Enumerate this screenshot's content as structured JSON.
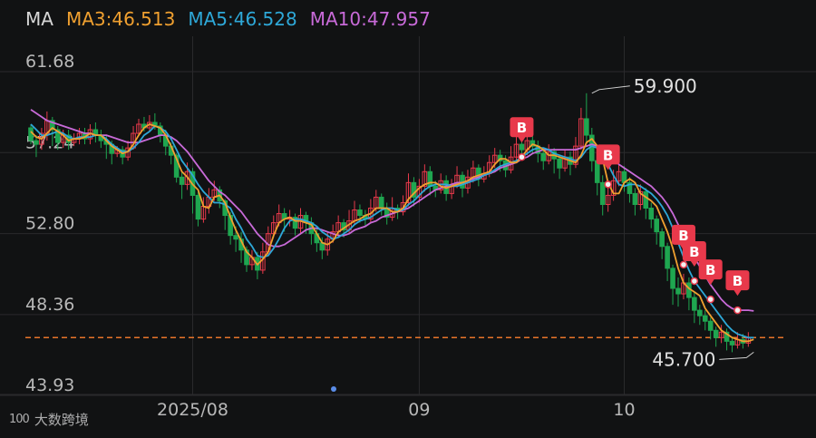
{
  "legend": {
    "ma_label": "MA",
    "ma3": "MA3:46.513",
    "ma5": "MA5:46.528",
    "ma10": "MA10:47.957"
  },
  "watermark": {
    "logo": "100",
    "text": "大数跨境"
  },
  "colors": {
    "background": "#111213",
    "grid": "#2a2a2c",
    "up": "#e8394b",
    "down": "#1fa650",
    "ma3": "#f0a030",
    "ma5": "#2ea8d8",
    "ma10": "#c86ad8",
    "current_line": "#e8742a",
    "axis_text": "#b8b8b8",
    "marker": "#e8394b"
  },
  "chart_data": {
    "type": "candlestick",
    "y_ticks": [
      "61.68",
      "57.24",
      "52.80",
      "48.36",
      "43.93"
    ],
    "y_tick_values": [
      61.68,
      57.24,
      52.8,
      48.36,
      43.93
    ],
    "x_ticks": [
      {
        "label": "2025/08",
        "index": 30
      },
      {
        "label": "09",
        "index": 72
      },
      {
        "label": "10",
        "index": 110
      }
    ],
    "grid": true,
    "current_price_line": 46.5,
    "max_label": "59.900",
    "max_value": 59.9,
    "max_index": 104,
    "min_label": "45.700",
    "min_value": 45.7,
    "min_index": 134,
    "buy_signal_label": "B",
    "buy_signals": [
      {
        "index": 91,
        "price": 56.4
      },
      {
        "index": 107,
        "price": 54.9
      },
      {
        "index": 121,
        "price": 50.5
      },
      {
        "index": 123,
        "price": 49.6
      },
      {
        "index": 126,
        "price": 48.6
      },
      {
        "index": 131,
        "price": 48.0
      }
    ],
    "candles": [
      [
        58.0,
        57.3,
        58.2,
        57.1
      ],
      [
        57.3,
        57.1,
        57.6,
        56.4
      ],
      [
        57.1,
        57.7,
        58.0,
        56.8
      ],
      [
        57.7,
        58.4,
        58.9,
        57.3
      ],
      [
        58.4,
        57.9,
        58.6,
        57.0
      ],
      [
        57.9,
        57.2,
        58.1,
        56.8
      ],
      [
        57.2,
        57.6,
        57.9,
        56.9
      ],
      [
        57.6,
        57.2,
        57.9,
        56.8
      ],
      [
        57.2,
        57.4,
        57.7,
        57.0
      ],
      [
        57.4,
        57.7,
        58.0,
        57.1
      ],
      [
        57.7,
        57.4,
        58.0,
        57.1
      ],
      [
        57.4,
        57.9,
        58.2,
        57.1
      ],
      [
        57.9,
        57.6,
        58.3,
        57.2
      ],
      [
        57.6,
        57.3,
        57.9,
        56.9
      ],
      [
        57.3,
        57.1,
        57.6,
        56.3
      ],
      [
        57.1,
        56.6,
        57.3,
        56.0
      ],
      [
        56.6,
        56.8,
        57.0,
        56.4
      ],
      [
        56.8,
        56.4,
        57.0,
        56.0
      ],
      [
        56.4,
        56.9,
        57.3,
        56.2
      ],
      [
        56.9,
        57.7,
        58.1,
        56.8
      ],
      [
        57.7,
        58.2,
        58.5,
        57.6
      ],
      [
        58.2,
        58.0,
        58.6,
        57.8
      ],
      [
        58.0,
        58.3,
        58.7,
        57.8
      ],
      [
        58.3,
        58.1,
        58.8,
        57.9
      ],
      [
        58.1,
        57.6,
        58.3,
        57.2
      ],
      [
        57.6,
        57.0,
        57.9,
        56.5
      ],
      [
        57.0,
        56.5,
        57.2,
        56.0
      ],
      [
        56.5,
        55.3,
        56.6,
        55.0
      ],
      [
        55.3,
        54.9,
        55.6,
        54.1
      ],
      [
        54.9,
        55.6,
        56.1,
        54.6
      ],
      [
        55.6,
        54.3,
        55.8,
        53.3
      ],
      [
        54.3,
        53.0,
        54.5,
        52.6
      ],
      [
        53.0,
        53.7,
        54.2,
        52.8
      ],
      [
        53.7,
        54.2,
        54.7,
        53.3
      ],
      [
        54.2,
        54.6,
        55.1,
        54.0
      ],
      [
        54.6,
        54.0,
        54.8,
        53.6
      ],
      [
        54.0,
        53.2,
        54.1,
        52.4
      ],
      [
        53.2,
        52.1,
        53.4,
        51.6
      ],
      [
        52.1,
        51.9,
        52.6,
        51.2
      ],
      [
        51.9,
        51.3,
        52.3,
        50.6
      ],
      [
        51.3,
        50.5,
        51.5,
        50.1
      ],
      [
        50.5,
        50.9,
        51.3,
        50.2
      ],
      [
        50.9,
        50.2,
        51.2,
        49.7
      ],
      [
        50.2,
        51.2,
        51.7,
        50.0
      ],
      [
        51.2,
        52.2,
        52.6,
        51.0
      ],
      [
        52.2,
        52.8,
        53.2,
        52.0
      ],
      [
        52.8,
        53.3,
        53.8,
        52.6
      ],
      [
        53.3,
        53.0,
        53.6,
        52.3
      ],
      [
        53.0,
        53.1,
        53.5,
        52.6
      ],
      [
        53.1,
        52.5,
        53.3,
        52.1
      ],
      [
        52.5,
        53.2,
        53.6,
        52.2
      ],
      [
        53.2,
        52.8,
        53.4,
        52.2
      ],
      [
        52.8,
        52.2,
        53.1,
        51.6
      ],
      [
        52.2,
        51.7,
        52.5,
        51.2
      ],
      [
        51.7,
        51.3,
        52.0,
        50.8
      ],
      [
        51.3,
        51.9,
        52.3,
        51.0
      ],
      [
        51.9,
        52.3,
        52.7,
        51.7
      ],
      [
        52.3,
        52.8,
        53.2,
        52.1
      ],
      [
        52.8,
        52.4,
        53.0,
        52.0
      ],
      [
        52.4,
        52.9,
        53.5,
        52.2
      ],
      [
        52.9,
        53.5,
        54.0,
        52.7
      ],
      [
        53.5,
        53.2,
        53.8,
        52.8
      ],
      [
        53.2,
        53.0,
        53.5,
        52.6
      ],
      [
        53.0,
        53.6,
        54.1,
        52.8
      ],
      [
        53.6,
        54.2,
        54.6,
        53.4
      ],
      [
        54.2,
        53.6,
        54.4,
        53.2
      ],
      [
        53.6,
        53.1,
        53.9,
        52.7
      ],
      [
        53.1,
        53.6,
        54.2,
        52.9
      ],
      [
        53.6,
        53.4,
        53.8,
        53.0
      ],
      [
        53.4,
        53.9,
        54.3,
        53.2
      ],
      [
        53.9,
        55.0,
        55.5,
        53.7
      ],
      [
        55.0,
        54.2,
        55.3,
        53.7
      ],
      [
        54.2,
        54.8,
        55.2,
        53.9
      ],
      [
        54.8,
        55.6,
        56.0,
        54.5
      ],
      [
        55.6,
        54.8,
        55.9,
        54.3
      ],
      [
        54.8,
        54.6,
        55.1,
        54.2
      ],
      [
        54.6,
        55.1,
        55.5,
        54.4
      ],
      [
        55.1,
        54.4,
        55.4,
        54.0
      ],
      [
        54.4,
        54.9,
        55.2,
        54.1
      ],
      [
        54.9,
        55.4,
        55.9,
        54.7
      ],
      [
        55.4,
        54.7,
        55.6,
        54.2
      ],
      [
        54.7,
        55.3,
        55.7,
        54.4
      ],
      [
        55.3,
        55.8,
        56.2,
        55.0
      ],
      [
        55.8,
        55.2,
        56.0,
        54.8
      ],
      [
        55.2,
        55.5,
        55.9,
        55.0
      ],
      [
        55.5,
        56.1,
        56.5,
        55.3
      ],
      [
        56.1,
        56.5,
        56.9,
        55.8
      ],
      [
        56.5,
        56.2,
        56.8,
        55.6
      ],
      [
        56.2,
        55.7,
        56.5,
        55.3
      ],
      [
        55.7,
        56.4,
        57.0,
        55.5
      ],
      [
        56.4,
        57.1,
        57.6,
        56.1
      ],
      [
        57.1,
        56.8,
        57.4,
        56.3
      ],
      [
        56.8,
        57.3,
        57.7,
        56.5
      ],
      [
        57.3,
        57.0,
        57.6,
        56.6
      ],
      [
        57.0,
        56.6,
        57.3,
        56.1
      ],
      [
        56.6,
        56.2,
        56.9,
        55.7
      ],
      [
        56.2,
        56.7,
        57.1,
        56.0
      ],
      [
        56.7,
        56.3,
        56.9,
        55.5
      ],
      [
        56.3,
        55.8,
        56.5,
        55.2
      ],
      [
        55.8,
        56.4,
        56.8,
        55.6
      ],
      [
        56.4,
        56.0,
        56.7,
        55.4
      ],
      [
        56.0,
        57.0,
        57.5,
        55.8
      ],
      [
        57.0,
        58.5,
        59.1,
        56.8
      ],
      [
        58.5,
        57.6,
        59.9,
        57.2
      ],
      [
        57.6,
        56.2,
        58.0,
        55.6
      ],
      [
        56.2,
        55.0,
        56.5,
        54.3
      ],
      [
        55.0,
        53.8,
        55.4,
        53.2
      ],
      [
        53.8,
        54.3,
        54.9,
        53.4
      ],
      [
        54.3,
        55.1,
        55.7,
        54.0
      ],
      [
        55.1,
        55.6,
        56.0,
        54.8
      ],
      [
        55.6,
        55.0,
        55.9,
        54.5
      ],
      [
        55.0,
        54.4,
        55.3,
        53.9
      ],
      [
        54.4,
        53.8,
        54.7,
        53.2
      ],
      [
        53.8,
        54.5,
        54.9,
        53.5
      ],
      [
        54.5,
        53.6,
        54.7,
        53.0
      ],
      [
        53.6,
        53.0,
        53.9,
        52.5
      ],
      [
        53.0,
        52.3,
        53.2,
        51.6
      ],
      [
        52.3,
        51.5,
        52.5,
        50.8
      ],
      [
        51.5,
        50.3,
        51.7,
        49.6
      ],
      [
        50.3,
        49.2,
        50.5,
        48.3
      ],
      [
        49.2,
        48.9,
        49.8,
        48.2
      ],
      [
        48.9,
        49.5,
        50.0,
        48.6
      ],
      [
        49.5,
        48.7,
        49.8,
        48.0
      ],
      [
        48.7,
        48.0,
        49.0,
        47.3
      ],
      [
        48.0,
        47.7,
        48.3,
        47.2
      ],
      [
        47.7,
        47.4,
        48.0,
        46.9
      ],
      [
        47.4,
        46.9,
        47.6,
        46.4
      ],
      [
        46.9,
        46.5,
        47.1,
        46.0
      ],
      [
        46.5,
        46.8,
        47.2,
        46.2
      ],
      [
        46.8,
        46.3,
        47.0,
        45.8
      ],
      [
        46.3,
        46.1,
        46.5,
        45.7
      ],
      [
        46.1,
        46.4,
        46.8,
        45.9
      ],
      [
        46.4,
        46.2,
        46.7,
        45.9
      ],
      [
        46.2,
        46.5,
        46.8,
        46.0
      ]
    ],
    "ma3": [
      57.8,
      57.5,
      57.4,
      57.7,
      58.0,
      57.8,
      57.6,
      57.3,
      57.4,
      57.4,
      57.5,
      57.7,
      57.6,
      57.6,
      57.3,
      57.0,
      56.8,
      56.6,
      56.7,
      57.1,
      57.6,
      58.0,
      58.2,
      58.1,
      58.0,
      57.6,
      57.0,
      56.3,
      55.6,
      55.3,
      54.9,
      54.6,
      53.7,
      53.6,
      54.2,
      54.3,
      53.9,
      53.1,
      52.4,
      51.8,
      51.2,
      50.9,
      50.5,
      50.8,
      51.2,
      52.1,
      52.8,
      53.0,
      53.1,
      52.9,
      52.9,
      52.8,
      52.7,
      52.2,
      51.7,
      51.6,
      51.8,
      52.3,
      52.5,
      52.7,
      52.9,
      53.0,
      53.2,
      53.3,
      53.6,
      53.6,
      53.6,
      53.4,
      53.4,
      53.6,
      54.1,
      54.4,
      54.7,
      54.9,
      55.0,
      55.0,
      54.8,
      54.7,
      54.8,
      54.9,
      55.0,
      55.1,
      55.3,
      55.4,
      55.5,
      55.6,
      56.0,
      56.3,
      56.3,
      56.1,
      56.1,
      56.4,
      56.8,
      57.1,
      57.0,
      56.8,
      56.5,
      56.5,
      56.4,
      56.3,
      56.2,
      56.1,
      56.5,
      57.2,
      57.4,
      57.0,
      56.3,
      55.0,
      54.4,
      54.4,
      55.0,
      55.2,
      55.0,
      54.4,
      54.2,
      54.0,
      53.7,
      53.0,
      52.3,
      51.4,
      50.3,
      49.5,
      49.2,
      49.0,
      48.8,
      48.1,
      47.7,
      47.3,
      46.9,
      46.7,
      46.5,
      46.4,
      46.3,
      46.3,
      46.4
    ],
    "ma5": [
      58.2,
      57.9,
      57.6,
      57.6,
      57.7,
      57.8,
      57.7,
      57.5,
      57.4,
      57.5,
      57.5,
      57.5,
      57.6,
      57.6,
      57.4,
      57.1,
      56.9,
      56.7,
      56.7,
      56.9,
      57.2,
      57.6,
      57.8,
      58.1,
      58.0,
      57.8,
      57.4,
      56.8,
      56.2,
      55.8,
      55.4,
      54.9,
      54.5,
      54.2,
      53.9,
      53.9,
      53.8,
      53.6,
      53.0,
      52.5,
      51.9,
      51.5,
      51.0,
      50.9,
      51.0,
      51.4,
      51.9,
      52.5,
      52.9,
      53.0,
      53.0,
      52.9,
      52.8,
      52.6,
      52.3,
      52.1,
      51.9,
      52.0,
      52.2,
      52.4,
      52.7,
      52.9,
      53.0,
      53.1,
      53.3,
      53.5,
      53.6,
      53.6,
      53.5,
      53.5,
      53.8,
      54.0,
      54.3,
      54.6,
      54.8,
      54.9,
      54.9,
      54.9,
      54.8,
      54.8,
      54.9,
      55.0,
      55.1,
      55.2,
      55.4,
      55.5,
      55.7,
      55.9,
      56.0,
      56.1,
      56.2,
      56.4,
      56.6,
      56.8,
      56.9,
      56.9,
      56.8,
      56.6,
      56.5,
      56.4,
      56.3,
      56.2,
      56.4,
      56.8,
      57.0,
      56.9,
      56.6,
      56.0,
      55.4,
      54.9,
      54.8,
      54.9,
      54.9,
      54.8,
      54.6,
      54.4,
      54.1,
      53.7,
      53.2,
      52.5,
      51.7,
      50.9,
      50.2,
      49.6,
      49.2,
      48.8,
      48.4,
      48.0,
      47.6,
      47.2,
      46.9,
      46.7,
      46.6,
      46.5,
      46.5
    ],
    "ma10": [
      59.0,
      58.8,
      58.6,
      58.4,
      58.3,
      58.2,
      58.1,
      58.0,
      57.9,
      57.8,
      57.7,
      57.7,
      57.6,
      57.6,
      57.6,
      57.5,
      57.4,
      57.3,
      57.2,
      57.2,
      57.2,
      57.3,
      57.4,
      57.5,
      57.6,
      57.6,
      57.5,
      57.3,
      57.0,
      56.7,
      56.3,
      55.9,
      55.5,
      55.1,
      54.8,
      54.5,
      54.3,
      54.0,
      53.7,
      53.4,
      53.0,
      52.6,
      52.2,
      51.9,
      51.6,
      51.5,
      51.5,
      51.6,
      51.8,
      52.0,
      52.2,
      52.4,
      52.5,
      52.5,
      52.4,
      52.3,
      52.2,
      52.1,
      52.1,
      52.2,
      52.4,
      52.5,
      52.6,
      52.8,
      52.9,
      53.1,
      53.2,
      53.3,
      53.4,
      53.5,
      53.6,
      53.8,
      54.0,
      54.2,
      54.4,
      54.6,
      54.7,
      54.8,
      54.9,
      55.0,
      55.0,
      55.1,
      55.2,
      55.3,
      55.4,
      55.5,
      55.6,
      55.8,
      55.9,
      56.0,
      56.1,
      56.3,
      56.4,
      56.6,
      56.7,
      56.8,
      56.8,
      56.8,
      56.8,
      56.8,
      56.8,
      56.8,
      56.9,
      57.0,
      57.1,
      57.0,
      56.9,
      56.6,
      56.3,
      56.0,
      55.8,
      55.6,
      55.4,
      55.2,
      55.0,
      54.8,
      54.5,
      54.2,
      53.8,
      53.3,
      52.7,
      52.1,
      51.5,
      50.9,
      50.4,
      49.9,
      49.4,
      49.0,
      48.6,
      48.3,
      48.1,
      48.0,
      48.0,
      48.0,
      47.96
    ]
  }
}
